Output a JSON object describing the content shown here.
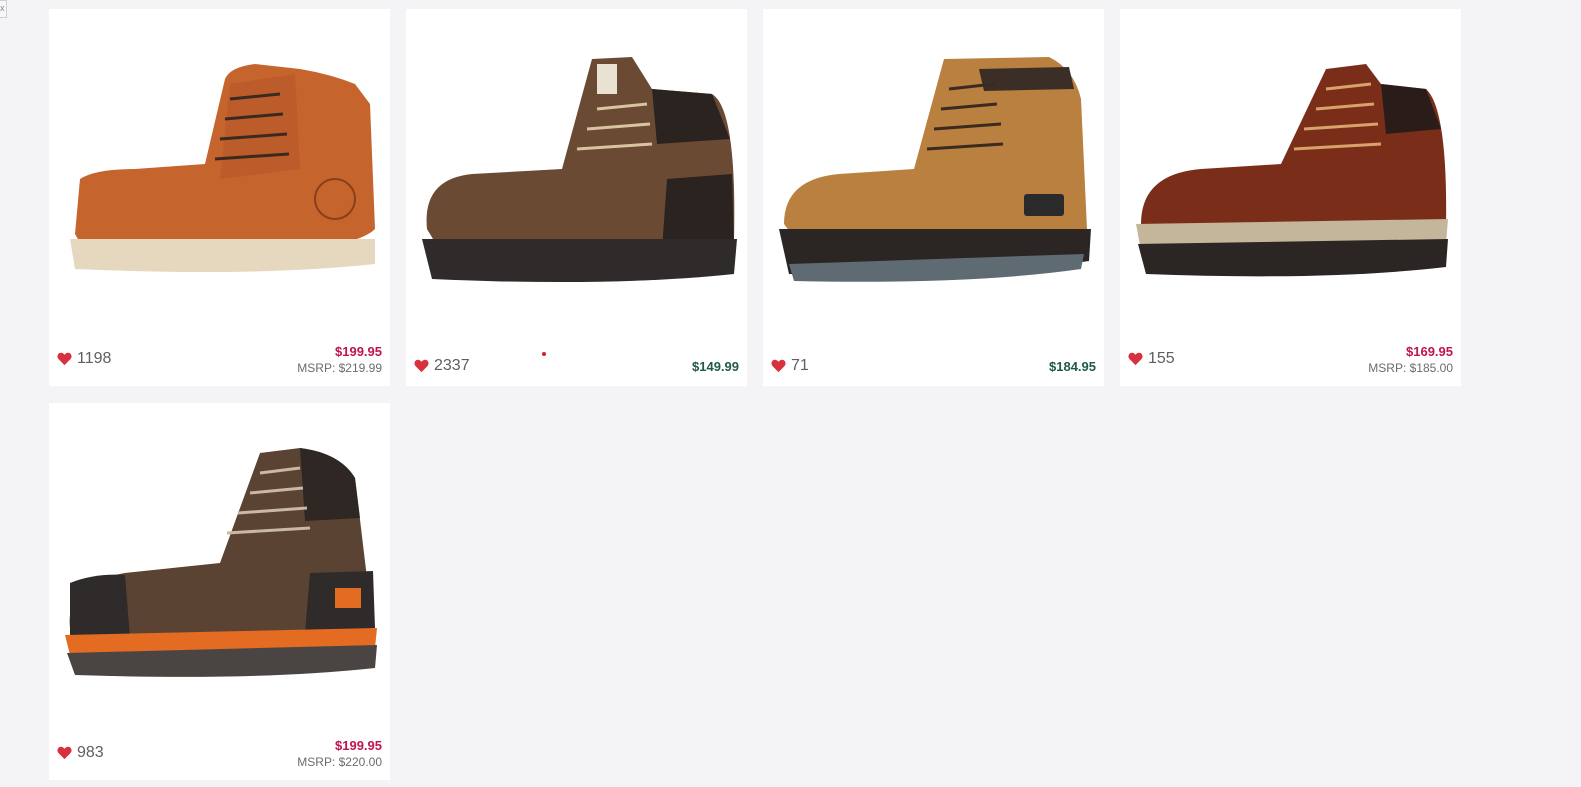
{
  "corner_glyph": "x",
  "products": [
    {
      "likes": "1198",
      "price": "$199.95",
      "price_type": "sale",
      "msrp": "MSRP: $219.99",
      "icon": "boot-image-tan-wedge",
      "color": "#c5642d"
    },
    {
      "likes": "2337",
      "price": "$149.99",
      "price_type": "regular",
      "msrp": "",
      "icon": "boot-image-brown-carhartt",
      "color": "#6b4a33"
    },
    {
      "likes": "71",
      "price": "$184.95",
      "price_type": "regular",
      "msrp": "",
      "icon": "boot-image-tan-ariat",
      "color": "#b9803f"
    },
    {
      "likes": "155",
      "price": "$169.95",
      "price_type": "sale",
      "msrp": "MSRP: $185.00",
      "icon": "boot-image-red-brown-wolverine",
      "color": "#7a2e1a"
    },
    {
      "likes": "983",
      "price": "$199.95",
      "price_type": "sale",
      "msrp": "MSRP: $220.00",
      "icon": "boot-image-brown-timberland-pro",
      "color": "#5a4332"
    }
  ],
  "colors": {
    "sale_price": "#c1144a",
    "regular_price": "#1f5a4a",
    "heart": "#d9303d",
    "background": "#f4f3f6"
  }
}
